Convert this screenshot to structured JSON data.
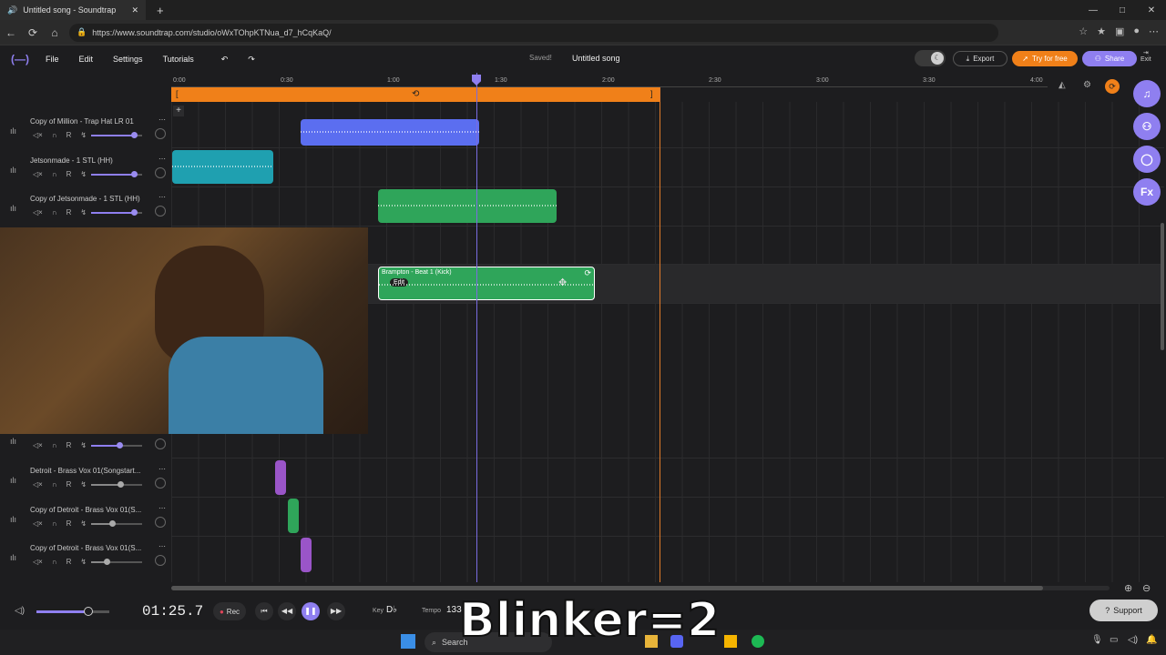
{
  "browser": {
    "tab_title": "Untitled song - Soundtrap",
    "url": "https://www.soundtrap.com/studio/oWxTOhpKTNua_d7_hCqKaQ/",
    "new_tab": "+",
    "minimize": "—",
    "maximize": "□",
    "close": "✕"
  },
  "app": {
    "menu": [
      "File",
      "Edit",
      "Settings",
      "Tutorials"
    ],
    "saved": "Saved!",
    "song_title": "Untitled song",
    "export": "Export",
    "try_free": "Try for free",
    "share": "Share",
    "exit": "Exit"
  },
  "timeline": {
    "ticks": [
      "0:00",
      "0:30",
      "1:00",
      "1:30",
      "2:00",
      "2:30",
      "3:00",
      "3:30",
      "4:00"
    ]
  },
  "tracks": [
    {
      "name": "Copy of Million - Trap Hat LR 01"
    },
    {
      "name": "Jetsonmade - 1 STL (HH)"
    },
    {
      "name": "Copy of Jetsonmade - 1 STL (HH)"
    },
    {
      "name": ""
    },
    {
      "name": ""
    },
    {
      "name": "Detroit - Brass Vox 01(Songstart..."
    },
    {
      "name": "Copy of Detroit - Brass Vox 01(S..."
    },
    {
      "name": "Copy of Detroit - Brass Vox 01(S..."
    }
  ],
  "selected_clip": {
    "name": "Brampton - Beat 1 (Kick)",
    "edit": "Edit"
  },
  "transport": {
    "time": "01:25.7",
    "rec": "Rec",
    "key_label": "Key",
    "key": "D♭",
    "tempo_label": "Tempo",
    "tempo": "133"
  },
  "overlay_text": "Blinker=2",
  "support": "Support",
  "taskbar": {
    "search": "Search"
  },
  "colors": {
    "accent": "#8f7ff0",
    "loop": "#f08019",
    "clip_blue": "#5b6ef0",
    "clip_teal": "#1fa0b0",
    "clip_green": "#2fa55a",
    "clip_purple": "#9a55c8"
  }
}
